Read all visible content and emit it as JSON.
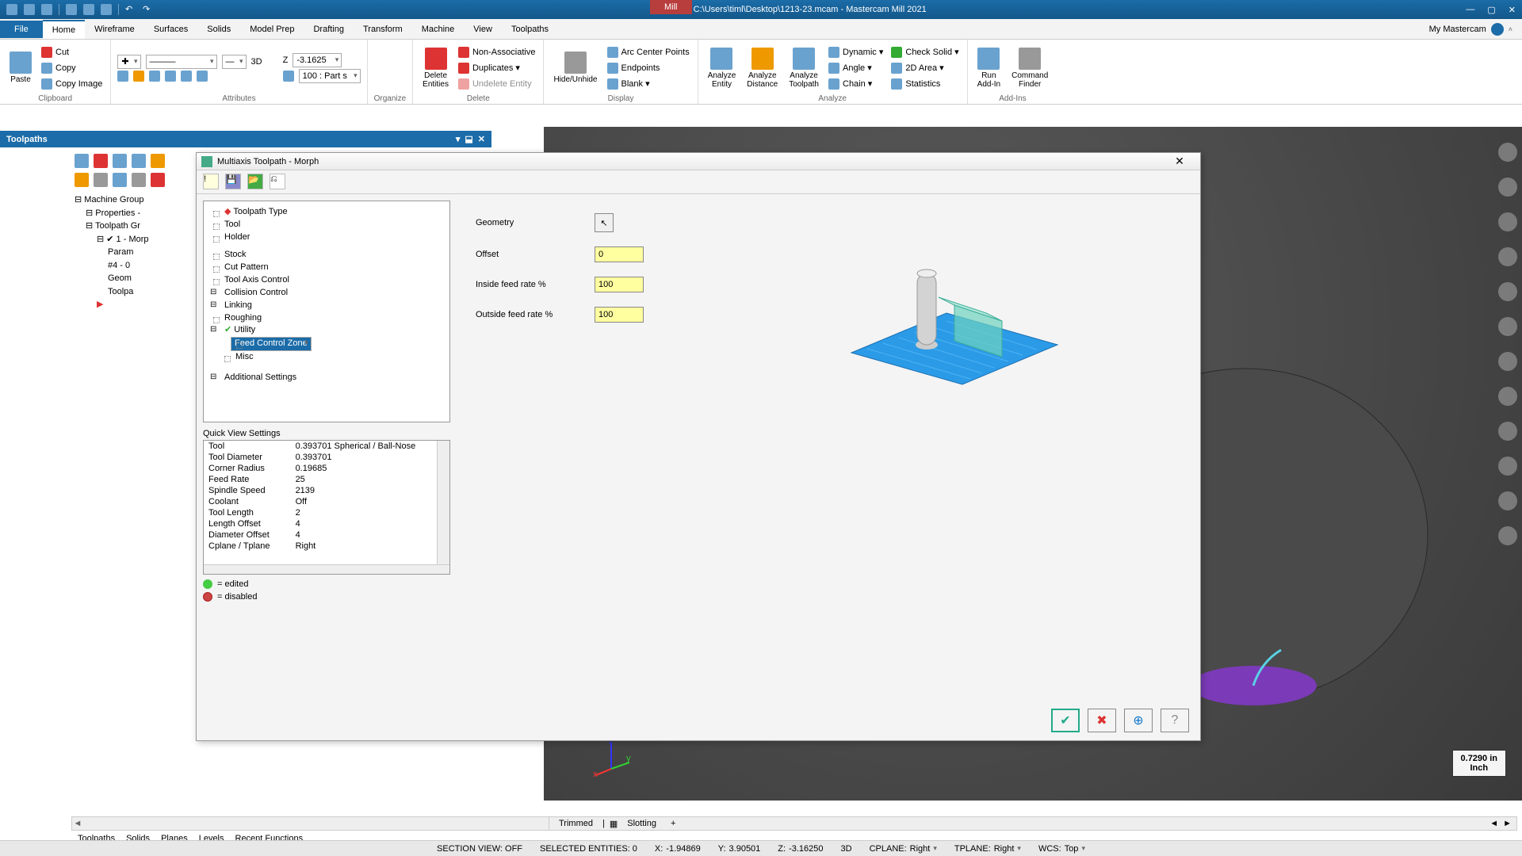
{
  "window": {
    "title": "C:\\Users\\timl\\Desktop\\1213-23.mcam - Mastercam Mill 2021",
    "context_tab": "Mill",
    "mymastercam": "My Mastercam"
  },
  "tabs": [
    "File",
    "Home",
    "Wireframe",
    "Surfaces",
    "Solids",
    "Model Prep",
    "Drafting",
    "Transform",
    "Machine",
    "View",
    "Toolpaths"
  ],
  "active_tab": "Home",
  "ribbon": {
    "clipboard": {
      "label": "Clipboard",
      "paste": "Paste",
      "cut": "Cut",
      "copy": "Copy",
      "copy_image": "Copy Image"
    },
    "attributes": {
      "label": "Attributes",
      "mode": "3D",
      "z_label": "Z",
      "z_value": "-3.1625",
      "level": "100 : Part s"
    },
    "organize": {
      "label": "Organize",
      "delete_entities": "Delete\nEntities",
      "non_assoc": "Non-Associative",
      "duplicates": "Duplicates ▾",
      "undelete": "Undelete Entity"
    },
    "delete": {
      "label": "Delete"
    },
    "display": {
      "label": "Display",
      "hide": "Hide/Unhide",
      "arc_center": "Arc Center Points",
      "endpoints": "Endpoints",
      "blank": "Blank ▾"
    },
    "analyze": {
      "label": "Analyze",
      "entity": "Analyze\nEntity",
      "distance": "Analyze\nDistance",
      "toolpath": "Analyze\nToolpath",
      "dynamic": "Dynamic ▾",
      "check_solid": "Check Solid ▾",
      "angle": "Angle ▾",
      "twod_area": "2D Area ▾",
      "chain": "Chain ▾",
      "statistics": "Statistics"
    },
    "addins": {
      "label": "Add-Ins",
      "run": "Run\nAdd-In",
      "cmdfinder": "Command\nFinder"
    }
  },
  "toolpaths_panel": {
    "title": "Toolpaths",
    "tree": [
      "Machine Group",
      "Properties -",
      "Toolpath Gr",
      "1 - Morp",
      "Param",
      "#4 - 0",
      "Geom",
      "Toolpa"
    ]
  },
  "dialog": {
    "title": "Multiaxis Toolpath - Morph",
    "tree": [
      "Toolpath Type",
      "Tool",
      "Holder",
      "Stock",
      "Cut Pattern",
      "Tool Axis Control",
      "Collision Control",
      "Linking",
      "Roughing",
      "Utility",
      "Feed Control Zone",
      "Misc",
      "Additional Settings"
    ],
    "selected": "Feed Control Zone",
    "form": {
      "geometry": "Geometry",
      "offset_label": "Offset",
      "offset": "0",
      "inside_label": "Inside feed rate %",
      "inside": "100",
      "outside_label": "Outside feed rate %",
      "outside": "100"
    },
    "qvs_title": "Quick View Settings",
    "qvs": [
      [
        "Tool",
        "0.393701 Spherical / Ball-Nose"
      ],
      [
        "Tool Diameter",
        "0.393701"
      ],
      [
        "Corner Radius",
        "0.19685"
      ],
      [
        "Feed Rate",
        "25"
      ],
      [
        "Spindle Speed",
        "2139"
      ],
      [
        "Coolant",
        "Off"
      ],
      [
        "Tool Length",
        "2"
      ],
      [
        "Length Offset",
        "4"
      ],
      [
        "Diameter Offset",
        "4"
      ],
      [
        "Cplane / Tplane",
        "Right"
      ]
    ],
    "legend": {
      "edited": "= edited",
      "disabled": "= disabled"
    }
  },
  "bottom_left_arrows": [
    "◄",
    "►"
  ],
  "bottom_right": {
    "trimmed": "Trimmed",
    "slotting": "Slotting",
    "plus": "+"
  },
  "bottom_tabs": [
    "Toolpaths",
    "Solids",
    "Planes",
    "Levels",
    "Recent Functions"
  ],
  "status": {
    "section": "SECTION VIEW: OFF",
    "selected": "SELECTED ENTITIES: 0",
    "x_lbl": "X:",
    "x": "-1.94869",
    "y_lbl": "Y:",
    "y": "3.90501",
    "z_lbl": "Z:",
    "z": "-3.16250",
    "mode": "3D",
    "cplane_lbl": "CPLANE:",
    "cplane": "Right",
    "tplane_lbl": "TPLANE:",
    "tplane": "Right",
    "wcs_lbl": "WCS:",
    "wcs": "Top"
  },
  "viewport": {
    "scale_val": "0.7290 in",
    "scale_unit": "Inch"
  }
}
